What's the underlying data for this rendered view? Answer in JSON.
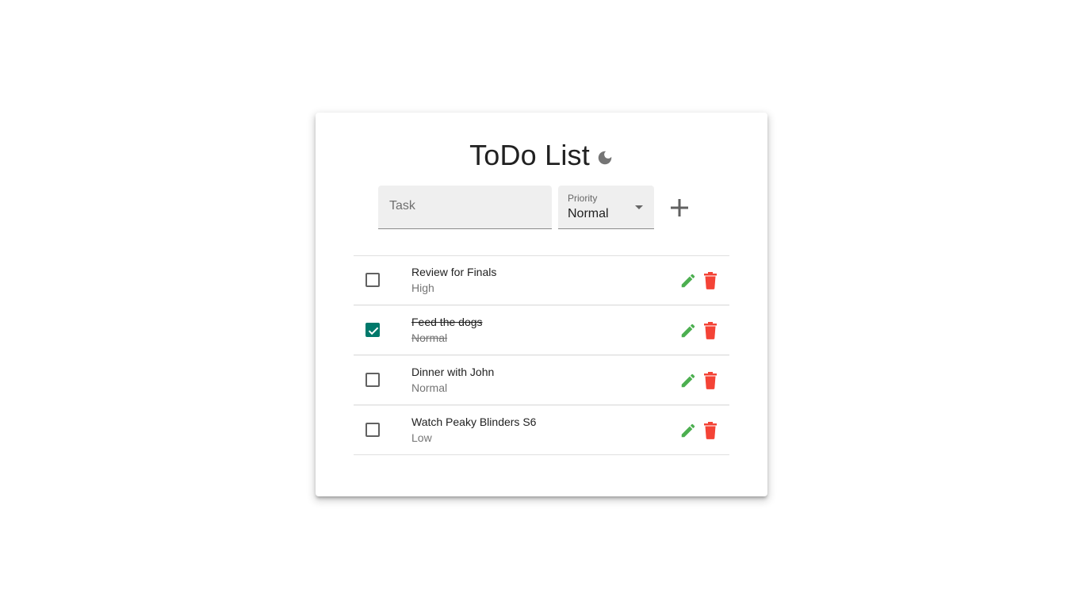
{
  "app": {
    "title": "ToDo List",
    "theme_toggle_icon": "moon-icon"
  },
  "form": {
    "task_placeholder": "Task",
    "task_value": "",
    "priority_label": "Priority",
    "priority_value": "Normal",
    "add_icon": "plus-icon"
  },
  "tasks": [
    {
      "name": "Review for Finals",
      "priority": "High",
      "done": false
    },
    {
      "name": "Feed the dogs",
      "priority": "Normal",
      "done": true
    },
    {
      "name": "Dinner with John",
      "priority": "Normal",
      "done": false
    },
    {
      "name": "Watch Peaky Blinders S6",
      "priority": "Low",
      "done": false
    }
  ],
  "colors": {
    "checkbox_checked": "#00796b",
    "edit_icon": "#4caf50",
    "delete_icon": "#f44336",
    "icon_gray": "#757575"
  }
}
